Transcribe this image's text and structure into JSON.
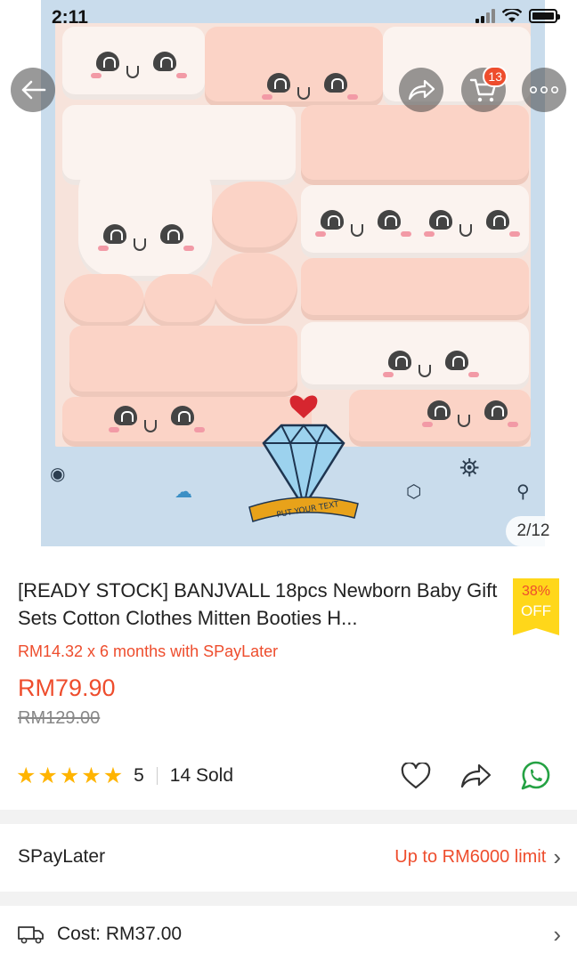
{
  "status_bar": {
    "time": "2:11"
  },
  "hero": {
    "image_counter": "2/12",
    "cart_count": "13",
    "badge_text": "PUT YOUR TEXT"
  },
  "product": {
    "title": "[READY STOCK] BANJVALL 18pcs Newborn Baby Gift Sets Cotton Clothes Mitten Booties H...",
    "discount_percent": "38%",
    "discount_off": "OFF",
    "spaylater_promo": "RM14.32 x 6 months with SPayLater",
    "price": "RM79.90",
    "original_price": "RM129.00",
    "rating": "5",
    "sold": "14 Sold"
  },
  "spaylater_row": {
    "label": "SPayLater",
    "limit": "Up to RM6000 limit"
  },
  "shipping_row": {
    "cost": "Cost: RM37.00"
  },
  "colors": {
    "accent": "#ee4d2d",
    "star": "#ffb400",
    "discount_bg": "#ffd71a",
    "whatsapp": "#25a244"
  }
}
